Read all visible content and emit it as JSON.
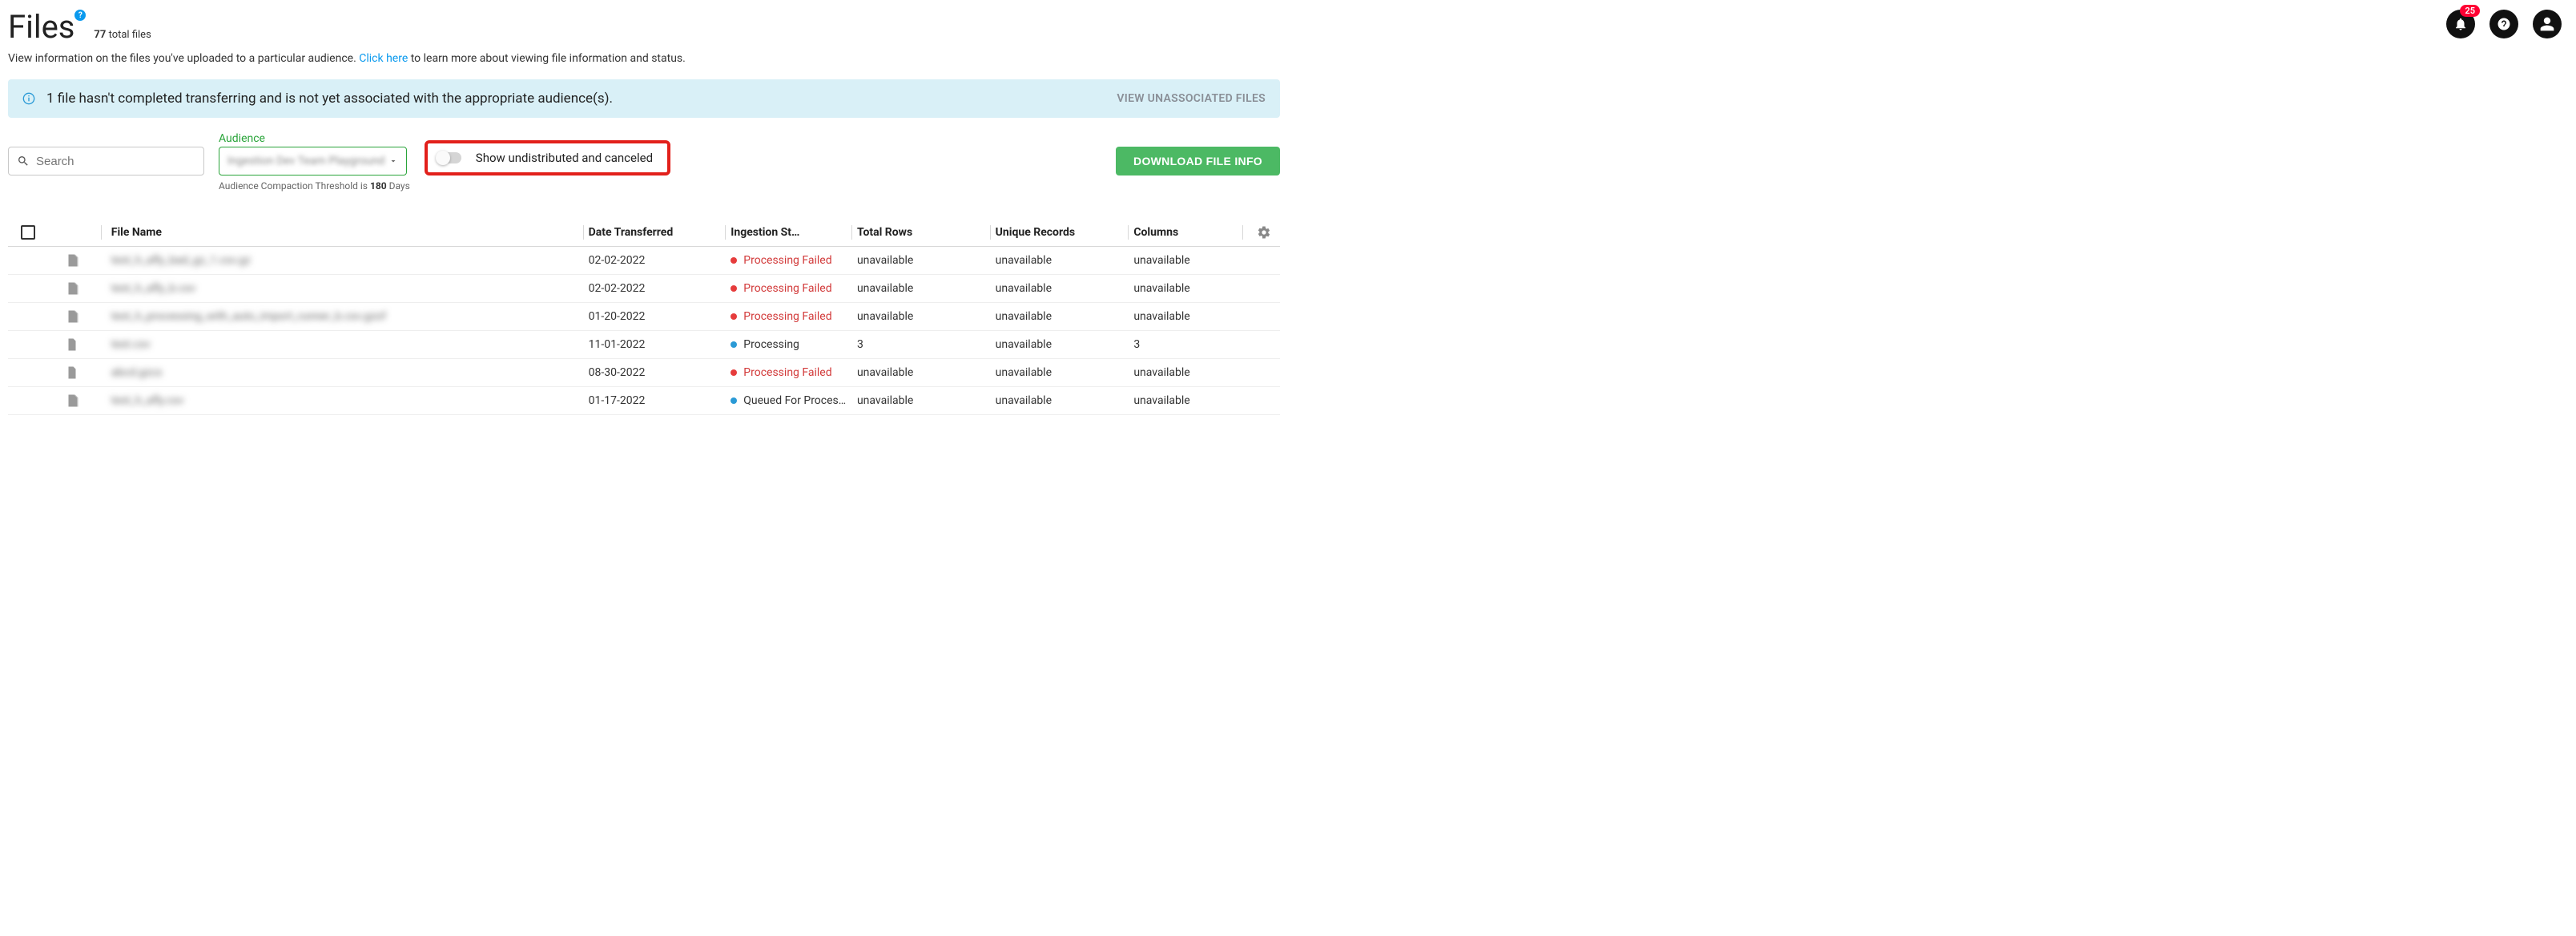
{
  "header": {
    "title": "Files",
    "help_glyph": "?",
    "count_value": "77",
    "count_label": " total files",
    "description_pre": "View information on the files you've uploaded to a particular audience. ",
    "description_link": "Click here",
    "description_post": " to learn more about viewing file information and status."
  },
  "notifications": {
    "badge": "25"
  },
  "banner": {
    "message": "1 file hasn't completed transferring and is not yet associated with the appropriate audience(s).",
    "action": "VIEW UNASSOCIATED FILES"
  },
  "controls": {
    "search_placeholder": "Search",
    "audience_label": "Audience",
    "audience_value": "Ingestion Dev Team Playground",
    "audience_hint_pre": "Audience Compaction Threshold is ",
    "audience_hint_bold": "180",
    "audience_hint_post": " Days",
    "toggle_label": "Show undistributed and canceled",
    "download_label": "DOWNLOAD FILE INFO"
  },
  "table": {
    "columns": {
      "name": "File Name",
      "date": "Date Transferred",
      "status": "Ingestion St…",
      "total": "Total Rows",
      "unique": "Unique Records",
      "cols": "Columns"
    },
    "rows": [
      {
        "icon": "doc",
        "name": "test_h_afly_bad_gz_1.csv.gz",
        "date": "02-02-2022",
        "status": "Processing Failed",
        "status_kind": "failed",
        "total": "unavailable",
        "unique": "unavailable",
        "cols": "unavailable"
      },
      {
        "icon": "doc",
        "name": "test_h_afly_b.csv",
        "date": "02-02-2022",
        "status": "Processing Failed",
        "status_kind": "failed",
        "total": "unavailable",
        "unique": "unavailable",
        "cols": "unavailable"
      },
      {
        "icon": "doc",
        "name": "test_h_processing_with_auto_import_runner_b.csv.gzof",
        "date": "01-20-2022",
        "status": "Processing Failed",
        "status_kind": "failed",
        "total": "unavailable",
        "unique": "unavailable",
        "cols": "unavailable"
      },
      {
        "icon": "file",
        "name": "test.csv",
        "date": "11-01-2022",
        "status": "Processing",
        "status_kind": "processing",
        "total": "3",
        "unique": "unavailable",
        "cols": "3"
      },
      {
        "icon": "file",
        "name": "abcd.gzcs",
        "date": "08-30-2022",
        "status": "Processing Failed",
        "status_kind": "failed",
        "total": "unavailable",
        "unique": "unavailable",
        "cols": "unavailable"
      },
      {
        "icon": "doc",
        "name": "test_h_afly.csv",
        "date": "01-17-2022",
        "status": "Queued For Processing",
        "status_kind": "queued",
        "total": "unavailable",
        "unique": "unavailable",
        "cols": "unavailable"
      }
    ]
  }
}
